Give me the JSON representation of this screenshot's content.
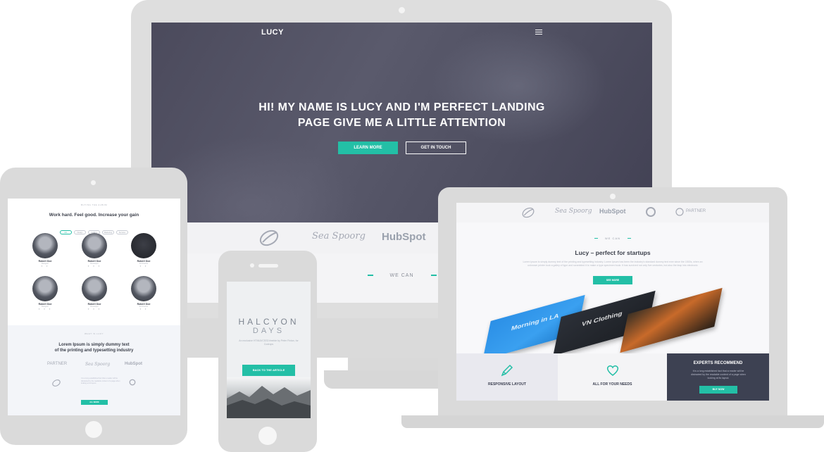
{
  "desktop": {
    "logo": "LUCY",
    "hero_title_line1": "HI! MY NAME IS LUCY AND I'M PERFECT LANDING",
    "hero_title_line2": "PAGE  GIVE ME A LITTLE ATTENTION",
    "learn_more": "LEARN MORE",
    "get_in_touch": "GET IN TOUCH",
    "brands": [
      "Sea Spoorg",
      "HubSpot"
    ],
    "we_can": "WE CAN"
  },
  "laptop": {
    "brands": [
      "Sea Spoorg",
      "HubSpot",
      "PARTNER"
    ],
    "we_can": "WE CAN",
    "title": "Lucy – perfect for startups",
    "lorem": "Lorem Ipsum is simply dummy text of the printing and typesetting industry. Lorem Ipsum has been the industry's standard dummy text ever since the 1500s, when an unknown printer took a galley of type and scrambled it to make a type specimen book. It has survived not only five centuries, but also the leap into electronic",
    "see_more": "SEE MORE",
    "phone_texts": [
      "Morning in LA",
      "VN Clothing",
      ""
    ],
    "tile1": "RESPONSIVE LAYOUT",
    "tile2": "ALL FOR YOUR NEEDS",
    "tile3_head": "EXPERTS RECOMMEND",
    "tile3_text": "It is a long established fact that a reader will be distracted by the readable content of a page when looking at its layout.",
    "buy_now": "BUY NOW"
  },
  "tablet": {
    "kicker": "BUYING THE ALBUM",
    "title": "Work hard. Feel good. Increase your gain",
    "filters": [
      "ALL",
      "Design",
      "Coding",
      "Marketing",
      "Services"
    ],
    "people": [
      {
        "name": "Robert Doe",
        "role": "Designer"
      },
      {
        "name": "Robert Doe",
        "role": "Developer"
      },
      {
        "name": "Robert Doe",
        "role": "Art Director"
      },
      {
        "name": "Robert Doe",
        "role": "Designer"
      },
      {
        "name": "Robert Doe",
        "role": "Developer"
      },
      {
        "name": "Robert Doe",
        "role": "Art Director"
      }
    ],
    "lower_kicker": "WHAT IS LUCY",
    "lower_title_line1": "Lorem Ipsum is simply dummy text",
    "lower_title_line2": "of the printing and typesetting industry",
    "logos": [
      "PARTNER",
      "Sea Spoorg",
      "HubSpot"
    ],
    "lower_btn": "ALL WORK"
  },
  "phone": {
    "title1": "HALCYON",
    "title2": "DAYS",
    "sub": "An exclusive HTML5/CSS3 freebie by Peter Finlan, for Codrops",
    "button": "BACK TO THE ARTICLE"
  },
  "colors": {
    "accent": "#23bfa6",
    "frame": "#dadada",
    "dark_tile": "#3d4152"
  }
}
